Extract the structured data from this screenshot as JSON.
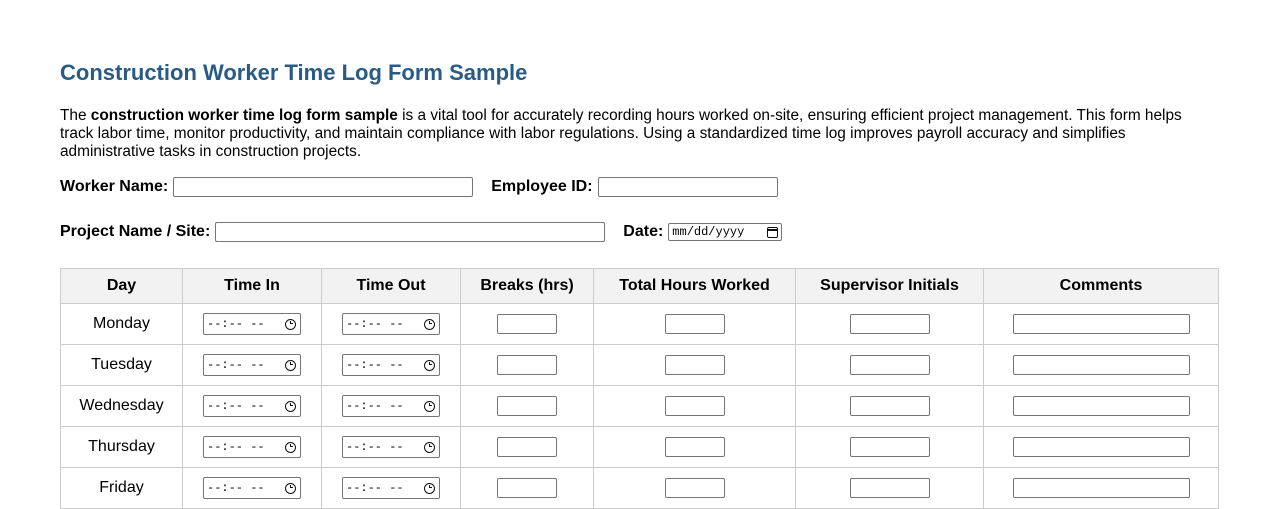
{
  "title": "Construction Worker Time Log Form Sample",
  "intro": {
    "prefix": "The ",
    "bold": "construction worker time log form sample",
    "suffix": " is a vital tool for accurately recording hours worked on-site, ensuring efficient project management. This form helps track labor time, monitor productivity, and maintain compliance with labor regulations. Using a standardized time log improves payroll accuracy and simplifies administrative tasks in construction projects."
  },
  "fields": {
    "worker_name_label": "Worker Name:",
    "worker_name_value": "",
    "employee_id_label": "Employee ID:",
    "employee_id_value": "",
    "project_label": "Project Name / Site:",
    "project_value": "",
    "date_label": "Date:",
    "date_placeholder": "mm/dd/yyyy"
  },
  "table": {
    "headers": [
      "Day",
      "Time In",
      "Time Out",
      "Breaks (hrs)",
      "Total Hours Worked",
      "Supervisor Initials",
      "Comments"
    ],
    "time_placeholder": "--:-- --",
    "days": [
      "Monday",
      "Tuesday",
      "Wednesday",
      "Thursday",
      "Friday"
    ]
  },
  "icons": {
    "calendar": "calendar-icon",
    "clock": "clock-icon"
  },
  "colors": {
    "title": "#2a5b84",
    "header_bg": "#f2f2f2",
    "border": "#cccccc"
  }
}
